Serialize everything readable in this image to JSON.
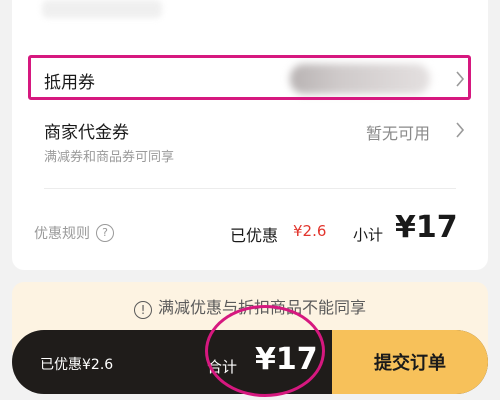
{
  "coupon_section": {
    "platform_coupon_label": "抵用券",
    "merchant_voucher_label": "商家代金券",
    "merchant_voucher_value": "暂无可用",
    "merchant_voucher_hint": "满减券和商品券可同享"
  },
  "summary": {
    "rules_label": "优惠规则",
    "rules_icon_text": "?",
    "discount_label": "已优惠",
    "discount_value": "¥2.6",
    "subtotal_label": "小计",
    "subtotal_value": "¥17"
  },
  "notice": {
    "icon_text": "!",
    "text": "满减优惠与折扣商品不能同享"
  },
  "bottom_bar": {
    "discount_text": "已优惠¥2.6",
    "total_label": "合计",
    "total_value": "¥17",
    "submit_label": "提交订单"
  },
  "colors": {
    "accent_red": "#e2352d",
    "submit_yellow": "#f7c15a",
    "bar_dark": "#1f1c1a",
    "annotation_pink": "#d6187f",
    "notice_bg": "#fdf3e2"
  },
  "icons": [
    "chevron-right-icon",
    "question-circle-icon",
    "exclamation-circle-icon"
  ]
}
